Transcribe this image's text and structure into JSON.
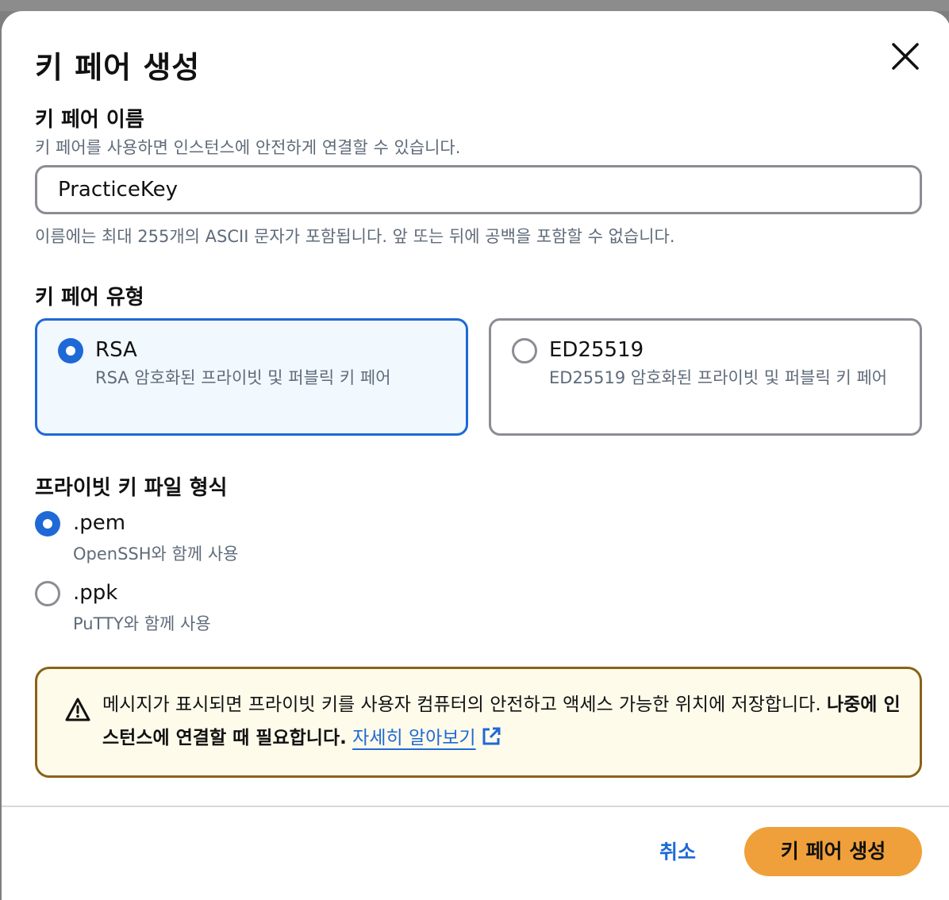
{
  "dialog": {
    "title": "키 페어 생성",
    "close_icon": "close-icon"
  },
  "key_name": {
    "label": "키 페어 이름",
    "description": "키 페어를 사용하면 인스턴스에 안전하게 연결할 수 있습니다.",
    "value": "PracticeKey",
    "hint": "이름에는 최대 255개의 ASCII 문자가 포함됩니다. 앞 또는 뒤에 공백을 포함할 수 없습니다."
  },
  "key_type": {
    "label": "키 페어 유형",
    "options": [
      {
        "title": "RSA",
        "description": "RSA 암호화된 프라이빗 및 퍼블릭 키 페어",
        "selected": true
      },
      {
        "title": "ED25519",
        "description": "ED25519 암호화된 프라이빗 및 퍼블릭 키 페어",
        "selected": false
      }
    ]
  },
  "file_format": {
    "label": "프라이빗 키 파일 형식",
    "options": [
      {
        "title": ".pem",
        "description": "OpenSSH와 함께 사용",
        "selected": true
      },
      {
        "title": ".ppk",
        "description": "PuTTY와 함께 사용",
        "selected": false
      }
    ]
  },
  "alert": {
    "icon": "warning-icon",
    "text": "메시지가 표시되면 프라이빗 키를 사용자 컴퓨터의 안전하고 액세스 가능한 위치에 저장합니다.",
    "bold_text": "나중에 인스턴스에 연결할 때 필요합니다.",
    "link_text": "자세히 알아보기",
    "link_icon": "external-link-icon",
    "border_color": "#8b6118",
    "background_color": "#fffbeb"
  },
  "footer": {
    "cancel_label": "취소",
    "create_label": "키 페어 생성",
    "create_color": "#f0a03a",
    "accent_color": "#1e69d6"
  }
}
